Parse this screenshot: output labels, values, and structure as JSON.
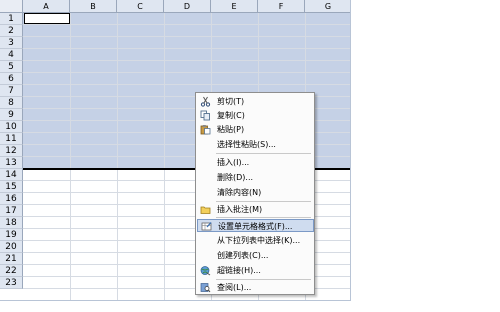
{
  "columns": [
    "A",
    "B",
    "C",
    "D",
    "E",
    "F",
    "G"
  ],
  "rows": [
    "1",
    "2",
    "3",
    "4",
    "5",
    "6",
    "7",
    "8",
    "9",
    "10",
    "11",
    "12",
    "13",
    "14",
    "15",
    "16",
    "17",
    "18",
    "19",
    "20",
    "21",
    "22",
    "23"
  ],
  "context_menu": {
    "cut": "剪切(T)",
    "copy": "复制(C)",
    "paste": "粘贴(P)",
    "paste_special": "选择性粘贴(S)...",
    "insert": "插入(I)...",
    "delete": "删除(D)...",
    "clear_contents": "清除内容(N)",
    "insert_comment": "插入批注(M)",
    "format_cells": "设置单元格格式(F)...",
    "pick_from_list": "从下拉列表中选择(K)...",
    "create_list": "创建列表(C)...",
    "hyperlink": "超链接(H)...",
    "lookup": "查阅(L)..."
  },
  "colors": {
    "selection": "#c5d1e6",
    "highlight": "#cfdcef"
  },
  "icons": {
    "cut": "scissors-icon",
    "copy": "copy-icon",
    "paste": "paste-icon",
    "comment": "comment-folder-icon",
    "format": "format-cells-icon",
    "hyperlink": "hyperlink-globe-icon",
    "lookup": "research-book-icon"
  }
}
